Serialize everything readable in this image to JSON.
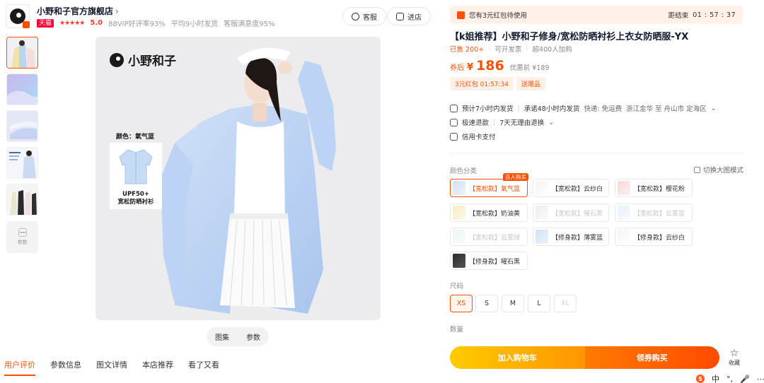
{
  "store": {
    "name": "小野和子官方旗舰店",
    "chevron": "›",
    "badge": "天猫",
    "stars": "★★★★★",
    "rating": "5.0",
    "stat1": "88VIP好评率93%",
    "stat2": "平均9小时发货",
    "stat3": "客服满意度95%",
    "service_label": "客服",
    "enter_label": "进店"
  },
  "thumbnails": {
    "more_label": "参数"
  },
  "main_image": {
    "brand": "小野和子",
    "inset_label": "颜色：氧气蓝",
    "inset_line1": "UPF50+",
    "inset_line2": "宽松防晒衬衫",
    "tabs": [
      "图集",
      "参数"
    ]
  },
  "bottom_nav": [
    "用户评价",
    "参数信息",
    "图文详情",
    "本店推荐",
    "看了又看"
  ],
  "coupon_bar": {
    "text": "您有3元红包待使用",
    "deadline_label": "距结束",
    "timer": "01 : 57 : 37"
  },
  "product": {
    "title": "【k姐推荐】小野和子修身/宽松防晒衬衫上衣女防晒服-YX",
    "sold": "已售 200+",
    "invoice": "可开发票",
    "favorites": "超400人加购",
    "price_label": "券后",
    "currency": "¥",
    "price": "186",
    "orig_price": "优惠前 ¥189",
    "promo1": "3元红包 01:57:34",
    "promo2": "送赠品"
  },
  "shipping": {
    "line1": "预计7小时内发货",
    "line1b": "承诺48小时内发货",
    "line1c": "快递: 免运费",
    "line1d": "浙江金华 至 舟山市 定海区",
    "line2": "极速退款",
    "line2b": "7天无理由退换",
    "line3": "信用卡支付"
  },
  "color_section": {
    "label": "颜色分类",
    "gallery_mode": "切换大图模式",
    "new_tag": "百人购买",
    "options": [
      "【宽松款】氧气蓝",
      "【宽松款】云纱白",
      "【宽松款】樱花粉",
      "【宽松款】奶油黄",
      "【宽松款】曜石黑",
      "【宽松款】云雾蓝",
      "【宽松款】云雾绿",
      "【修身款】薄雾蓝",
      "【修身款】云纱白",
      "【修身款】曜石黑"
    ]
  },
  "size_section": {
    "label": "尺码",
    "options": [
      "XS",
      "S",
      "M",
      "L",
      "XL"
    ]
  },
  "quantity_label": "数量",
  "actions": {
    "cart": "加入购物车",
    "buy": "领券购买",
    "favorite": "收藏"
  },
  "tray": {
    "s": "S",
    "ime": "中"
  }
}
